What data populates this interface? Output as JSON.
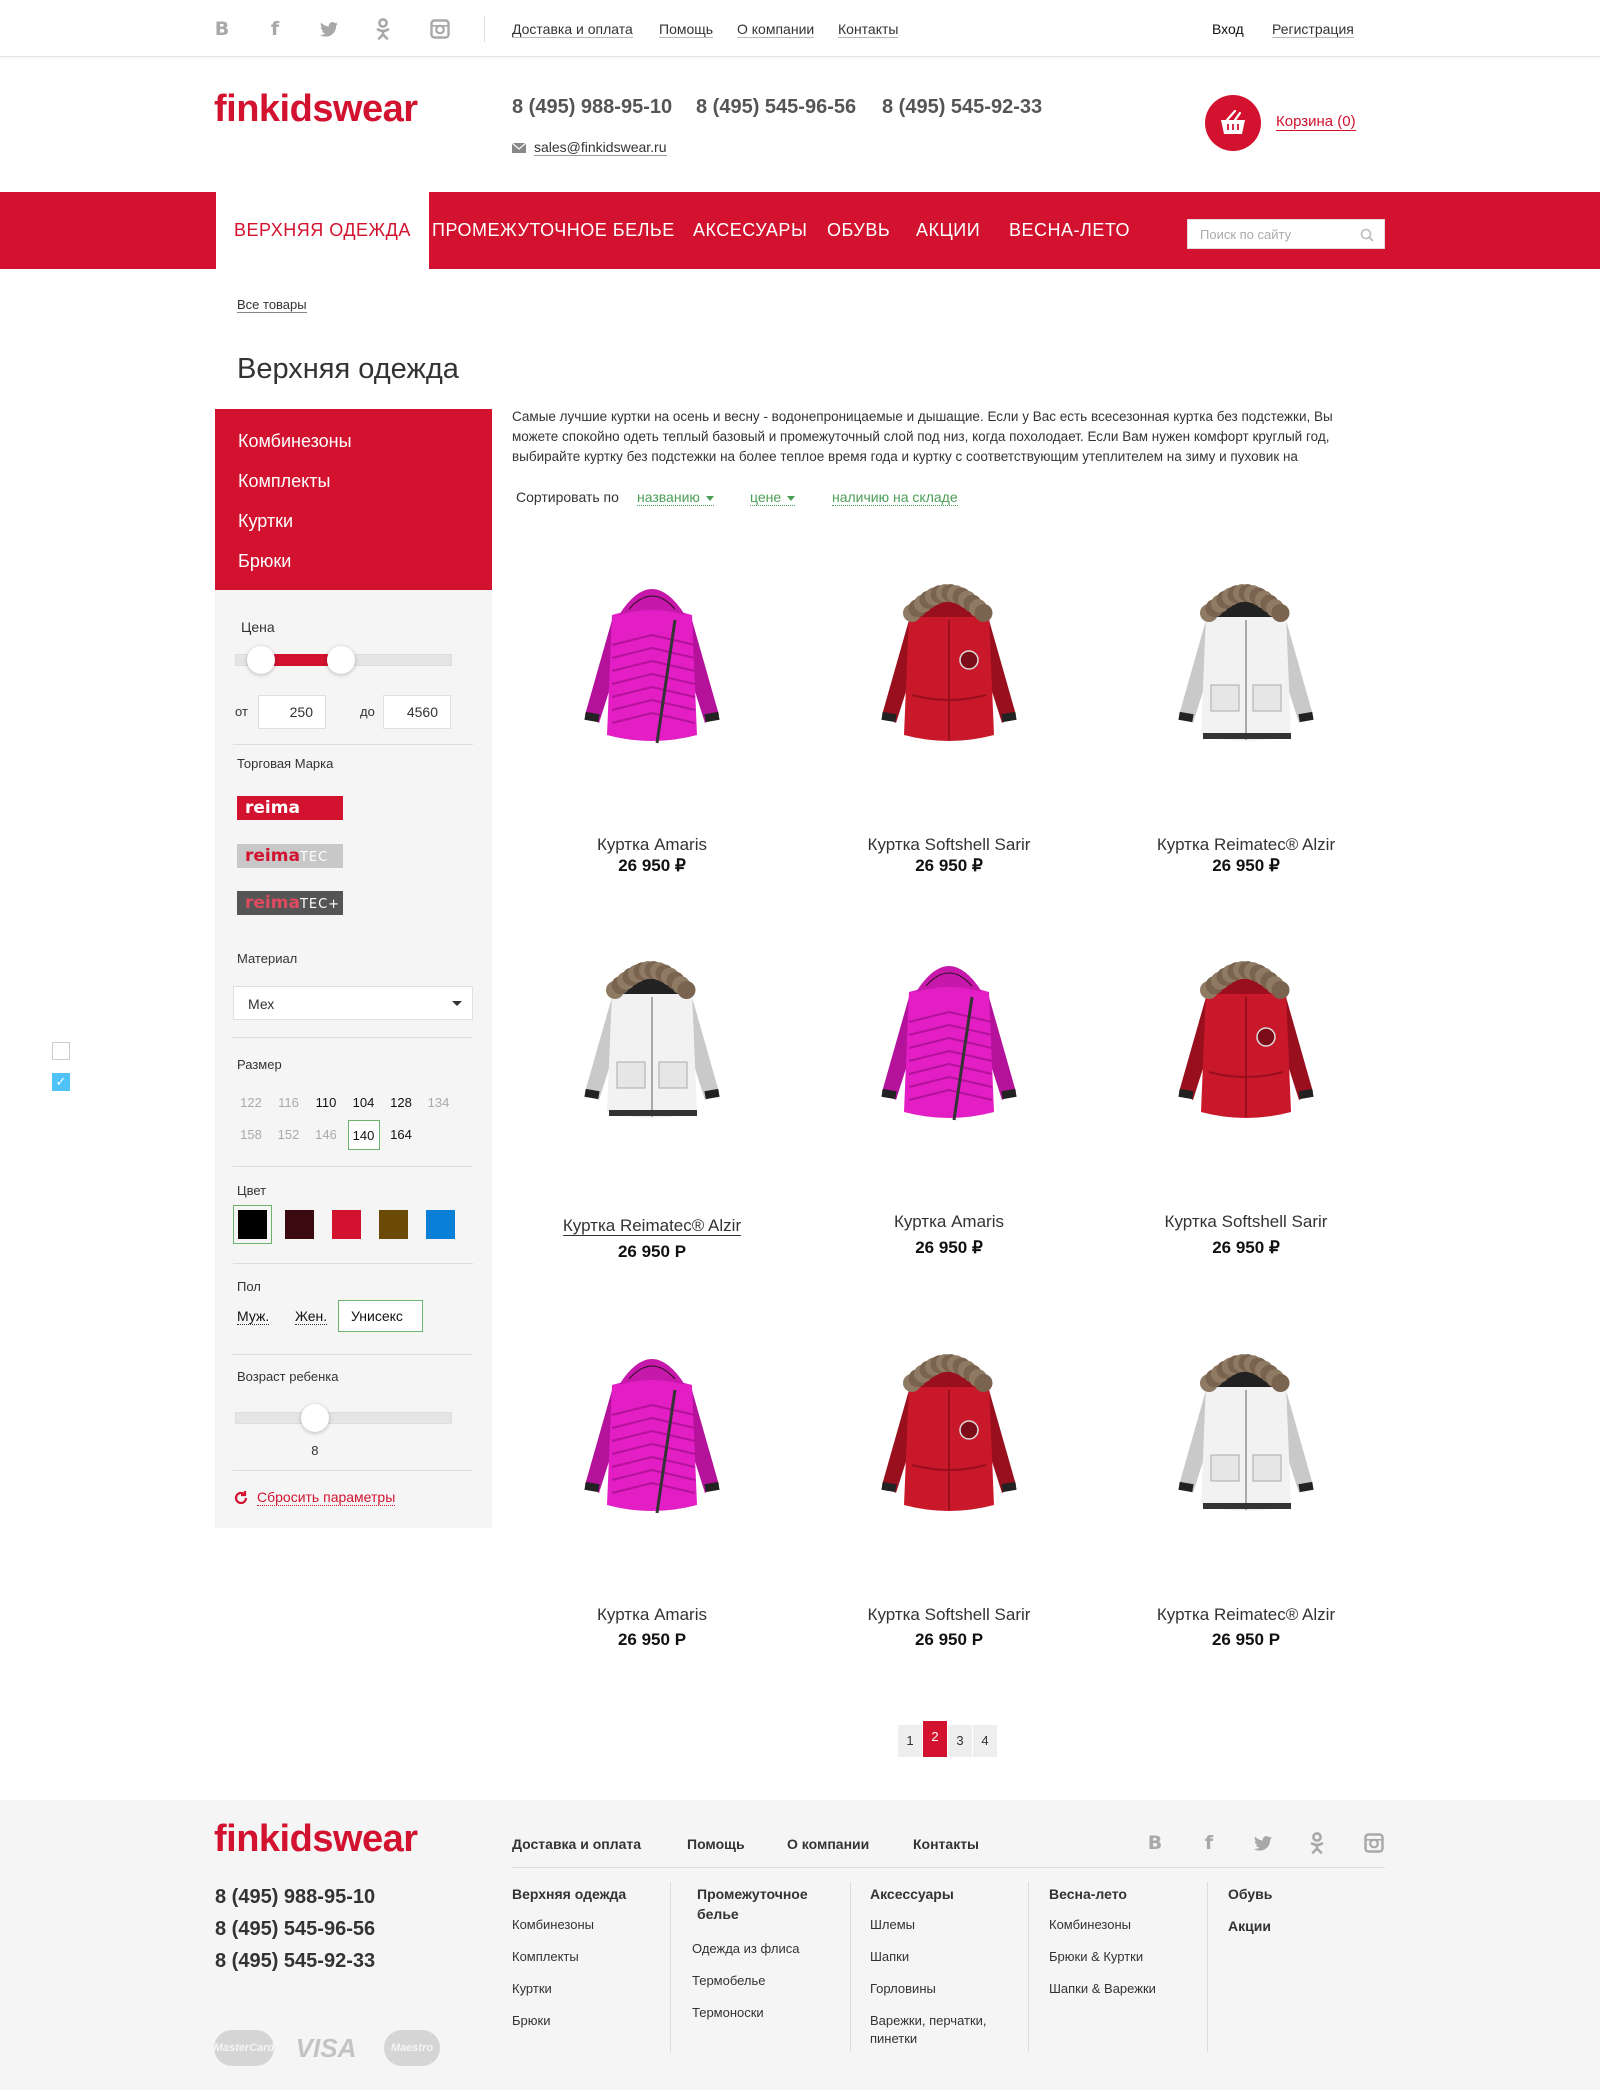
{
  "topbar": {
    "social": [
      {
        "icon": "vk-icon",
        "glyph": "B"
      },
      {
        "icon": "facebook-icon",
        "glyph": "f"
      },
      {
        "icon": "twitter-icon",
        "glyph": "🐦"
      },
      {
        "icon": "odnoklassniki-icon",
        "glyph": "ok"
      },
      {
        "icon": "instagram-icon",
        "glyph": "◘"
      }
    ],
    "links": [
      "Доставка и оплата",
      "Помощь",
      "О компании",
      "Контакты"
    ],
    "login": "Вход",
    "register": "Регистрация"
  },
  "header": {
    "logo": "finkidswear",
    "phones": [
      "8 (495) 988-95-10",
      "8 (495) 545-96-56",
      "8 (495) 545-92-33"
    ],
    "email": "sales@finkidswear.ru",
    "cart_label": "Корзина (0)"
  },
  "nav": {
    "items": [
      "ВЕРХНЯЯ ОДЕЖДА",
      "ПРОМЕЖУТОЧНОЕ БЕЛЬЕ",
      "АКСЕСУАРЫ",
      "ОБУВЬ",
      "АКЦИИ",
      "ВЕСНА-ЛЕТО"
    ],
    "search_placeholder": "Поиск по сайту"
  },
  "breadcrumb": "Все товары",
  "page_title": "Верхняя одежда",
  "sidebar": {
    "categories": [
      "Комбинезоны",
      "Комплекты",
      "Куртки",
      "Брюки"
    ],
    "price": {
      "label": "Цена",
      "from_label": "от",
      "from": "250",
      "to_label": "до",
      "to": "4560",
      "range_from_fraction": 0.12,
      "range_to_fraction": 0.49
    },
    "brand": {
      "label": "Торговая Марка",
      "items": [
        {
          "name": "reima",
          "suffix": ""
        },
        {
          "name": "reima",
          "suffix": "TEC"
        },
        {
          "name": "reima",
          "suffix": "TEC+"
        }
      ]
    },
    "material": {
      "label": "Материал",
      "value": "Мех"
    },
    "size": {
      "label": "Размер",
      "rows": [
        [
          {
            "v": "122",
            "s": "dim"
          },
          {
            "v": "116",
            "s": "dim"
          },
          {
            "v": "110",
            "s": "on"
          },
          {
            "v": "104",
            "s": "on"
          },
          {
            "v": "128",
            "s": "on"
          },
          {
            "v": "134",
            "s": "dim"
          }
        ],
        [
          {
            "v": "158",
            "s": "dim"
          },
          {
            "v": "152",
            "s": "dim"
          },
          {
            "v": "146",
            "s": "dim"
          },
          {
            "v": "140",
            "s": "sel"
          },
          {
            "v": "164",
            "s": "on"
          }
        ]
      ]
    },
    "color": {
      "label": "Цвет",
      "swatches": [
        "#000000",
        "#3b0a10",
        "#d2122e",
        "#6b4a05",
        "#0a7fd8"
      ],
      "selected": 0
    },
    "gender": {
      "label": "Пол",
      "options": [
        "Муж.",
        "Жен.",
        "Унисекс"
      ],
      "selected": 2
    },
    "age": {
      "label": "Возраст ребенка",
      "value": "8",
      "fraction": 0.37
    },
    "reset": "Сбросить параметры"
  },
  "description": "Самые лучшие куртки на осень и весну - водонепроницаемые и дышащие. Если у Вас есть всесезонная куртка без подстежки, Вы можете спокойно одеть теплый базовый и промежуточный слой под низ, когда похолодает. Если Вам нужен комфорт круглый год, выбирайте куртку без подстежки на более теплое время года и куртку с соответствующим утеплителем на зиму и пуховик на",
  "sort": {
    "label": "Сортировать по",
    "options": [
      "названию",
      "цене",
      "наличию на складе"
    ]
  },
  "products": [
    {
      "name": "Куртка Amaris",
      "price": "26 950 ₽",
      "kind": "pink"
    },
    {
      "name": "Куртка Softshell Sarir",
      "price": "26 950 ₽",
      "kind": "red"
    },
    {
      "name": "Куртка Reimatec® Alzir",
      "price": "26 950 ₽",
      "kind": "white"
    },
    {
      "name": "Куртка Reimatec® Alzir",
      "price": "26 950 Р",
      "kind": "white"
    },
    {
      "name": "Куртка Amaris",
      "price": "26 950 ₽",
      "kind": "pink"
    },
    {
      "name": "Куртка Softshell Sarir",
      "price": "26 950 ₽",
      "kind": "red"
    },
    {
      "name": "Куртка Amaris",
      "price": "26 950 Р",
      "kind": "pink"
    },
    {
      "name": "Куртка Softshell Sarir",
      "price": "26 950 Р",
      "kind": "red"
    },
    {
      "name": "Куртка Reimatec® Alzir",
      "price": "26 950 Р",
      "kind": "white"
    }
  ],
  "pagination": {
    "pages": [
      "1",
      "2",
      "3",
      "4"
    ],
    "current": "2"
  },
  "footer": {
    "logo": "finkidswear",
    "nav": [
      "Доставка и оплата",
      "Помощь",
      "О компании",
      "Контакты"
    ],
    "phones": [
      "8 (495) 988-95-10",
      "8 (495) 545-96-56",
      "8 (495) 545-92-33"
    ],
    "columns": [
      {
        "title": "Верхняя одежда",
        "items": [
          "Комбинезоны",
          "Комплекты",
          "Куртки",
          "Брюки"
        ]
      },
      {
        "title": "Промежуточное белье",
        "items": [
          "Одежда из флиса",
          "Термобелье",
          "Термоноски"
        ]
      },
      {
        "title": "Аксессуары",
        "items": [
          "Шлемы",
          "Шапки",
          "Горловины",
          "Варежки, перчатки, пинетки"
        ]
      },
      {
        "title": "Весна-лето",
        "items": [
          "Комбинезоны",
          "Брюки & Куртки",
          "Шапки & Варежки"
        ]
      },
      {
        "title": "Обувь",
        "items": []
      },
      {
        "title": "Акции",
        "items": []
      }
    ],
    "payments": [
      "MasterCard",
      "VISA",
      "Maestro"
    ]
  },
  "colors": {
    "brand_red": "#d2122e",
    "accent_green": "#4a9e55"
  }
}
